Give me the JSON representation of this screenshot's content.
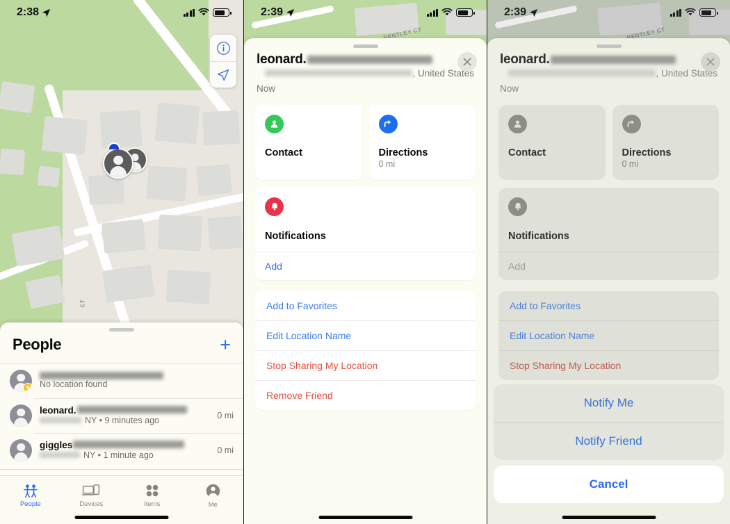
{
  "panels": [
    {
      "id": "map-people-list",
      "status": {
        "time": "2:38",
        "location_arrow": "location-arrow-icon",
        "signal": "cellular-bars-icon",
        "wifi": "wifi-icon",
        "battery": "battery-icon"
      },
      "map": {
        "road_label": "CT",
        "info_button": "info-circle-icon",
        "locate_button": "location-arrow-icon"
      },
      "people_sheet": {
        "title": "People",
        "add_label": "+",
        "rows": [
          {
            "name": "",
            "name_redacted": true,
            "subtitle": "No location found",
            "subtitle_redacted": false,
            "distance": "",
            "favorite": true
          },
          {
            "name": "leonard.",
            "name_redacted": true,
            "subtitle": "NY • 9 minutes ago",
            "subtitle_redacted": true,
            "distance": "0 mi",
            "favorite": false
          },
          {
            "name": "giggles",
            "name_redacted": true,
            "subtitle": "NY • 1 minute ago",
            "subtitle_redacted": true,
            "distance": "0 mi",
            "favorite": false
          }
        ]
      },
      "tabbar": [
        {
          "label": "People",
          "icon": "people-icon",
          "active": true
        },
        {
          "label": "Devices",
          "icon": "devices-icon",
          "active": false
        },
        {
          "label": "Items",
          "icon": "items-icon",
          "active": false
        },
        {
          "label": "Me",
          "icon": "person-circle-icon",
          "active": false
        }
      ]
    },
    {
      "id": "friend-detail-sheet",
      "status": {
        "time": "2:39"
      },
      "map": {
        "road_label": "BENTLEY CT"
      },
      "detail": {
        "title": "leonard.",
        "address_suffix": ", United States",
        "timestamp": "Now",
        "close_icon": "close-icon",
        "cards": [
          {
            "title": "Contact",
            "subtitle": "",
            "icon": "person-icon",
            "color": "#34c759"
          },
          {
            "title": "Directions",
            "subtitle": "0 mi",
            "icon": "directions-arrow-icon",
            "color": "#1d6ff2"
          }
        ],
        "notifications": {
          "title": "Notifications",
          "icon": "bell-icon",
          "color": "#e8334a",
          "action": "Add"
        },
        "actions": [
          {
            "label": "Add to Favorites",
            "style": "default"
          },
          {
            "label": "Edit Location Name",
            "style": "default"
          },
          {
            "label": "Stop Sharing My Location",
            "style": "danger"
          },
          {
            "label": "Remove Friend",
            "style": "danger"
          }
        ]
      }
    },
    {
      "id": "notify-action-sheet",
      "status": {
        "time": "2:39"
      },
      "map": {
        "road_label": "BENTLEY CT"
      },
      "detail": {
        "title": "leonard.",
        "address_suffix": ", United States",
        "timestamp": "Now",
        "close_icon": "close-icon",
        "cards": [
          {
            "title": "Contact",
            "subtitle": "",
            "icon": "person-icon",
            "color": "#8d8f87"
          },
          {
            "title": "Directions",
            "subtitle": "0 mi",
            "icon": "directions-arrow-icon",
            "color": "#8d8f87"
          }
        ],
        "notifications": {
          "title": "Notifications",
          "icon": "bell-icon",
          "color": "#8d8f87",
          "action": "Add"
        },
        "actions": [
          {
            "label": "Add to Favorites",
            "style": "default"
          },
          {
            "label": "Edit Location Name",
            "style": "default"
          },
          {
            "label": "Stop Sharing My Location",
            "style": "danger"
          }
        ]
      },
      "action_sheet": {
        "options": [
          {
            "label": "Notify Me"
          },
          {
            "label": "Notify Friend"
          }
        ],
        "cancel": "Cancel"
      }
    }
  ],
  "colors": {
    "accent_blue": "#2b6bf3",
    "danger_red": "#e5503f",
    "green": "#34c759",
    "bell_red": "#e8334a",
    "map_green": "#bcd9a0",
    "sheet_bg": "#fcfdf2"
  }
}
